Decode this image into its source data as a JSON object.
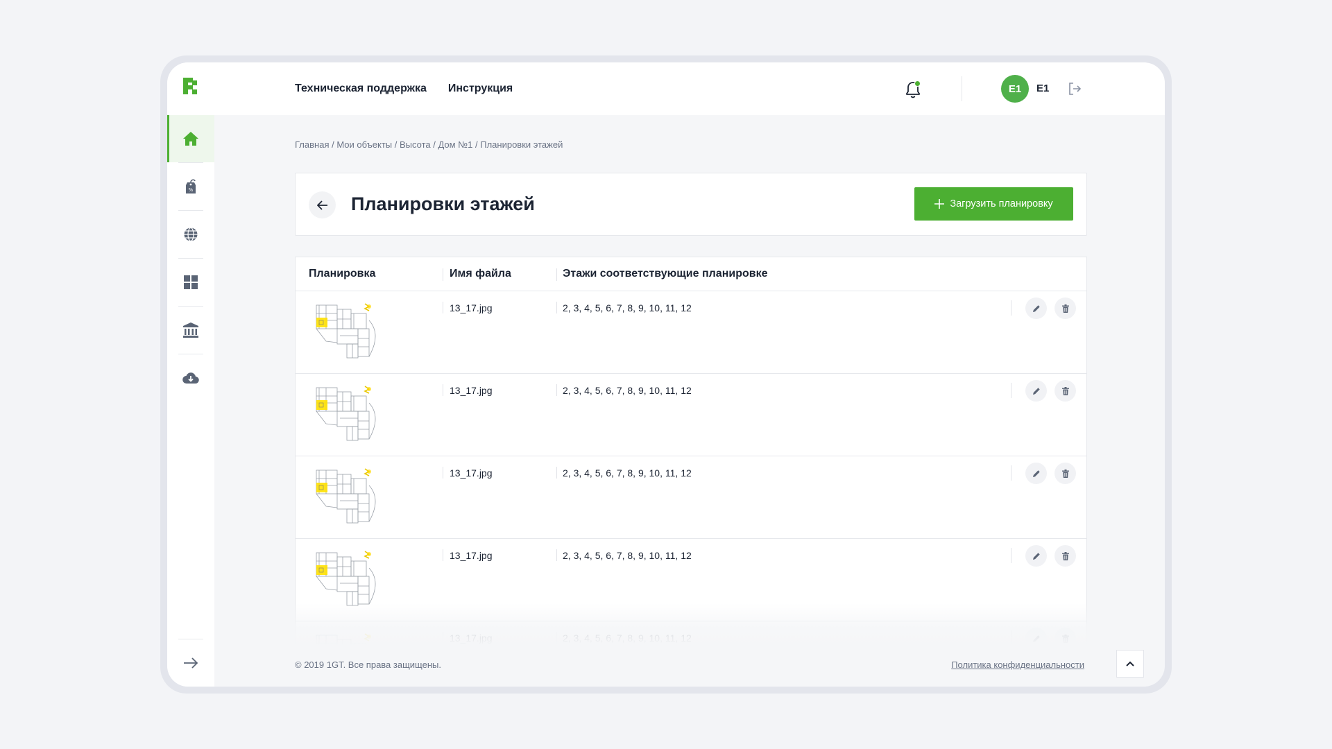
{
  "header": {
    "nav": [
      "Техническая поддержка",
      "Инструкция"
    ],
    "avatar_initials": "E1",
    "username": "E1"
  },
  "sidebar": {
    "items": [
      "home-icon",
      "price-tag-icon",
      "globe-icon",
      "grid-icon",
      "bank-icon",
      "cloud-download-icon"
    ],
    "bottom": "arrow-right-icon"
  },
  "breadcrumb": [
    "Главная",
    "Мои объекты",
    "Высота",
    "Дом №1",
    "Планировки этажей"
  ],
  "page": {
    "title": "Планировки этажей",
    "upload_label": "Загрузить планировку"
  },
  "table": {
    "columns": [
      "Планировка",
      "Имя файла",
      "Этажи соответствующие планировке"
    ],
    "rows": [
      {
        "file": "13_17.jpg",
        "floors": "2, 3, 4, 5, 6, 7, 8, 9, 10, 11, 12"
      },
      {
        "file": "13_17.jpg",
        "floors": "2, 3, 4, 5, 6, 7, 8, 9, 10, 11, 12"
      },
      {
        "file": "13_17.jpg",
        "floors": "2, 3, 4, 5, 6, 7, 8, 9, 10, 11, 12"
      },
      {
        "file": "13_17.jpg",
        "floors": "2, 3, 4, 5, 6, 7, 8, 9, 10, 11, 12"
      },
      {
        "file": "13_17.jpg",
        "floors": "2, 3, 4, 5, 6, 7, 8, 9, 10, 11, 12"
      }
    ]
  },
  "footer": {
    "copyright": "© 2019 1GT. Все права защищены.",
    "privacy": "Политика конфиденциальности"
  },
  "colors": {
    "accent": "#4caf32",
    "avatar": "#4fb04a",
    "text": "#1c2433",
    "muted": "#6a7385"
  }
}
